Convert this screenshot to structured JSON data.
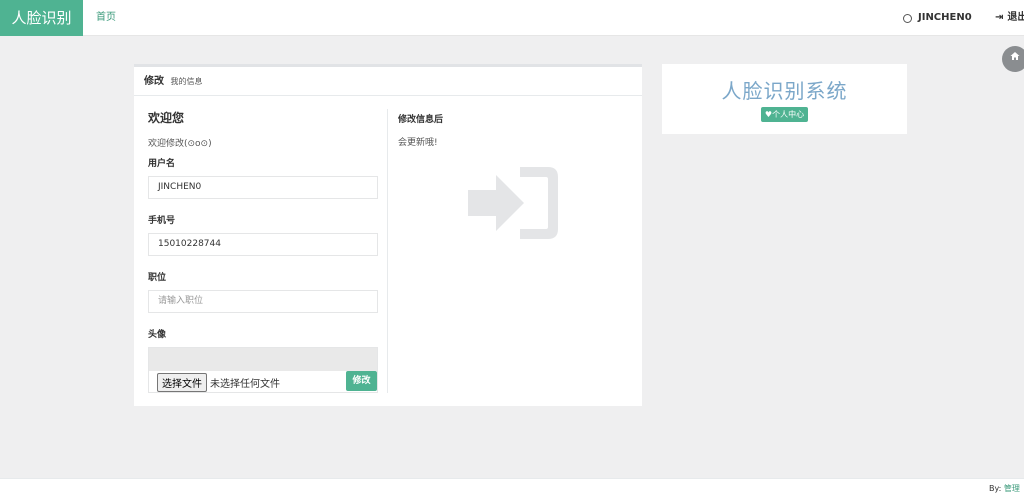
{
  "brand": "人脸识别",
  "nav": {
    "home": "首页"
  },
  "user": {
    "name": "JINCHEN0",
    "logout": "退出"
  },
  "panel": {
    "title": "修改",
    "subtitle": "我的信息",
    "greeting": "欢迎您",
    "welcome": "欢迎修改(⊙o⊙)",
    "fields": {
      "username": {
        "label": "用户名",
        "value": "JINCHEN0"
      },
      "phone": {
        "label": "手机号",
        "value": "15010228744"
      },
      "position": {
        "label": "职位",
        "placeholder": "请输入职位"
      },
      "avatar": {
        "label": "头像",
        "choose": "选择文件",
        "none": "未选择任何文件"
      }
    },
    "submit": "修改",
    "right_title": "修改信息后",
    "right_text": "会更新哦!"
  },
  "card": {
    "title": "人脸识别系统",
    "badge": "个人中心"
  },
  "footer": {
    "by": "By:",
    "author": "管理"
  },
  "colors": {
    "accent": "#4fb392",
    "card_title": "#7ba7c9"
  }
}
